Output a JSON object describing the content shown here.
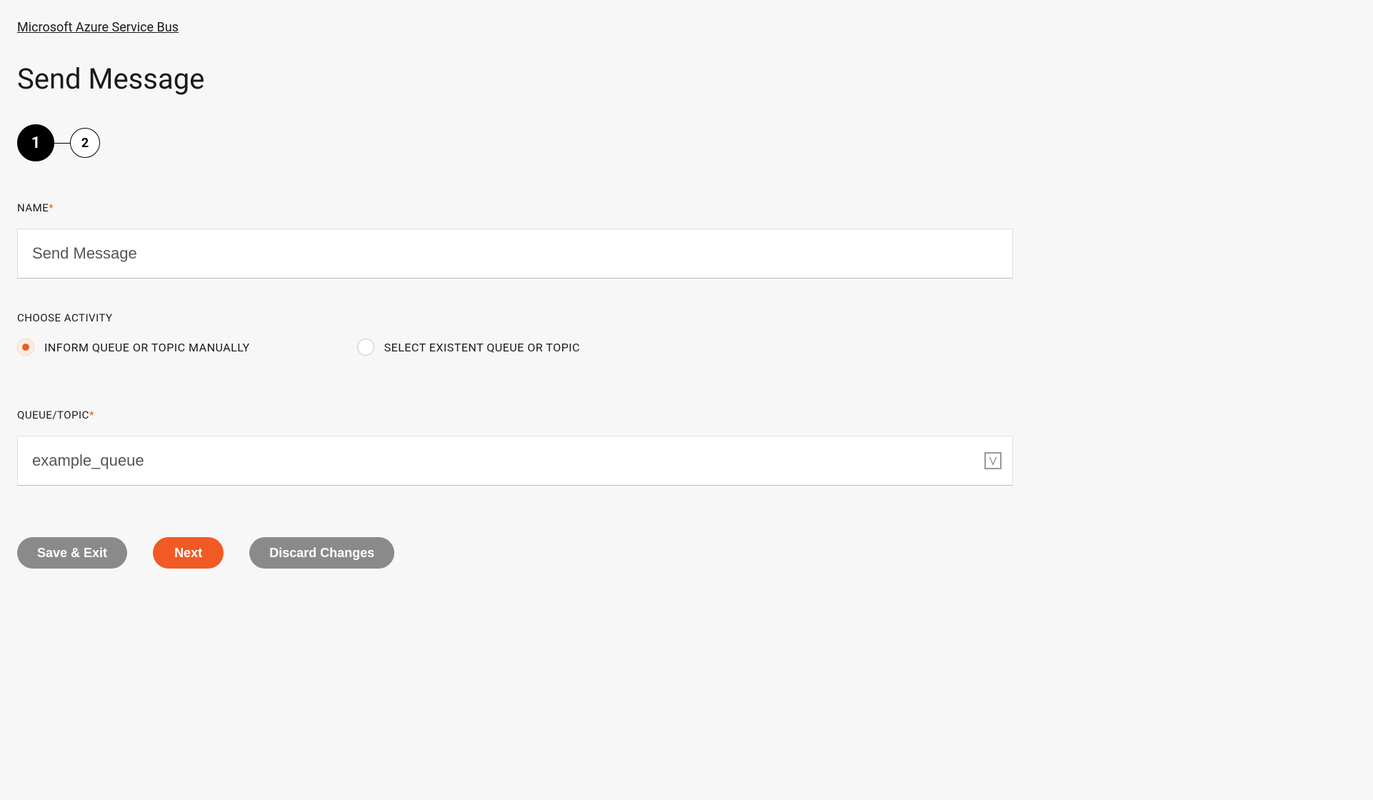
{
  "breadcrumb": "Microsoft Azure Service Bus",
  "page_title": "Send Message",
  "stepper": {
    "steps": [
      "1",
      "2"
    ],
    "active_index": 0
  },
  "form": {
    "name": {
      "label": "NAME",
      "required_marker": "*",
      "value": "Send Message"
    },
    "choose_activity": {
      "label": "CHOOSE ACTIVITY",
      "options": [
        {
          "label": "INFORM QUEUE OR TOPIC MANUALLY",
          "selected": true
        },
        {
          "label": "SELECT EXISTENT QUEUE OR TOPIC",
          "selected": false
        }
      ]
    },
    "queue_topic": {
      "label": "QUEUE/TOPIC",
      "required_marker": "*",
      "value": "example_queue"
    }
  },
  "buttons": {
    "save_exit": "Save & Exit",
    "next": "Next",
    "discard": "Discard Changes"
  }
}
